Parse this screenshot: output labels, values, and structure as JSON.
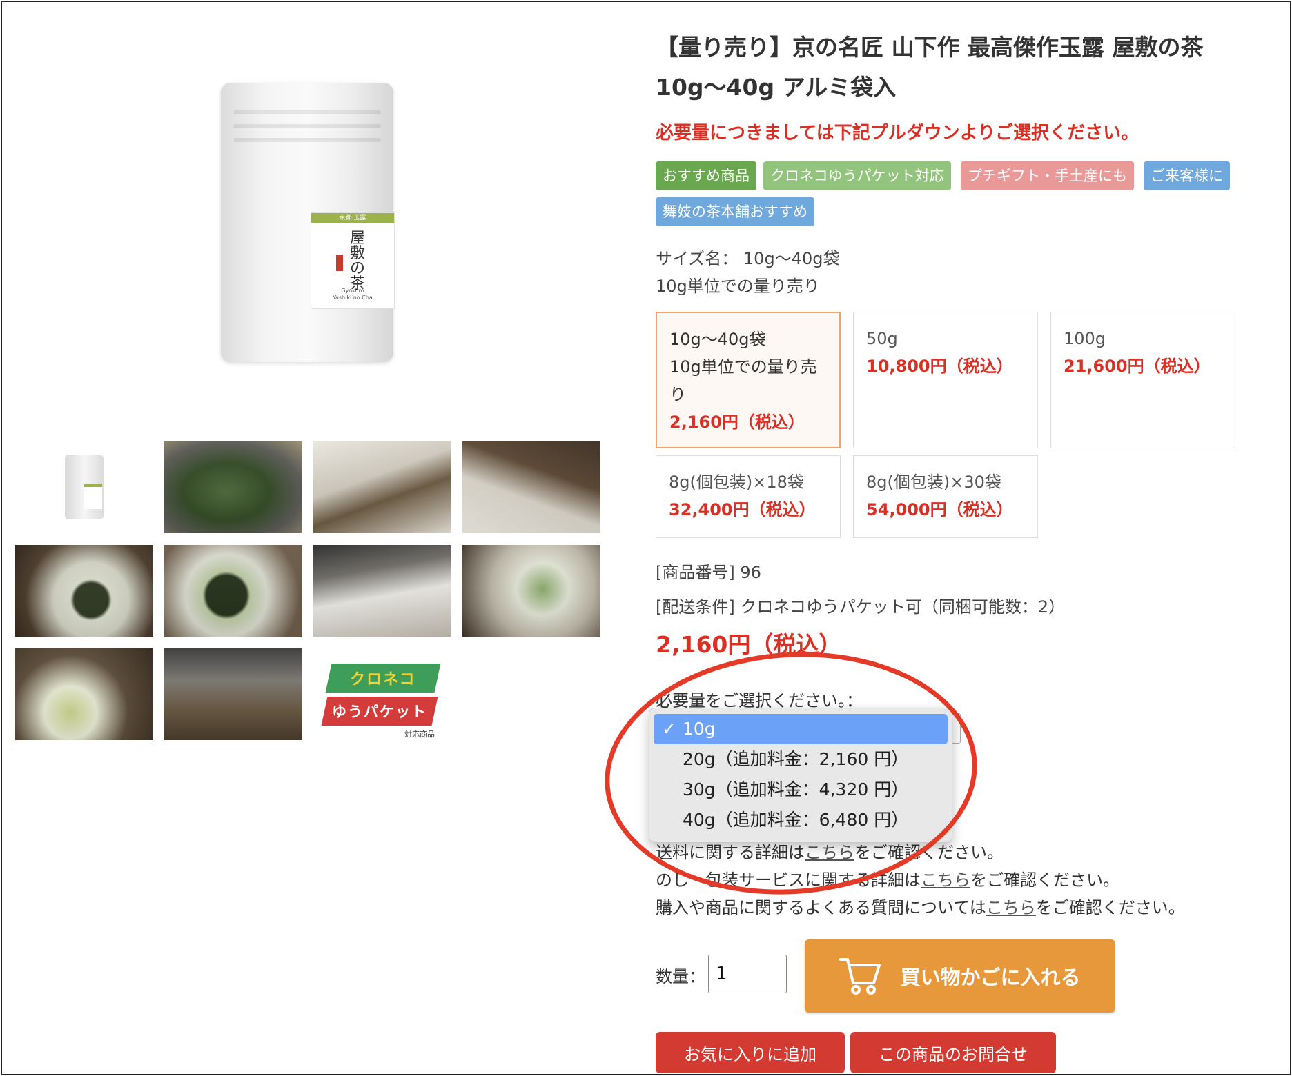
{
  "product": {
    "title_line1": "【量り売り】京の名匠 山下作 最高傑作玉露 屋敷の茶",
    "title_line2": "10g〜40g アルミ袋入",
    "notice": "必要量につきましては下記プルダウンよりご選択ください。",
    "tags": [
      {
        "label": "おすすめ商品",
        "color": "#6aa84f"
      },
      {
        "label": "クロネコゆうパケット対応",
        "color": "#93c47d"
      },
      {
        "label": "プチギフト・手土産にも",
        "color": "#ea9999"
      },
      {
        "label": "ご来客様に",
        "color": "#6fa8dc"
      },
      {
        "label": "舞妓の茶本舗おすすめ",
        "color": "#6fa8dc"
      }
    ],
    "size_name": "サイズ名： 10g〜40g袋",
    "size_note": "10g単位での量り売り",
    "options": [
      {
        "line1": "10g〜40g袋",
        "line2": "10g単位での量り売",
        "line3": "り",
        "price": "2,160円（税込）",
        "selected": true
      },
      {
        "line1": "50g",
        "price": "10,800円（税込）",
        "selected": false
      },
      {
        "line1": "100g",
        "price": "21,600円（税込）",
        "selected": false
      },
      {
        "line1": "8g(個包装)×18袋",
        "price": "32,400円（税込）",
        "selected": false
      },
      {
        "line1": "8g(個包装)×30袋",
        "price": "54,000円（税込）",
        "selected": false
      }
    ],
    "item_number": "[商品番号] 96",
    "shipping": "[配送条件] クロネコゆうパケット可（同梱可能数：2）",
    "price": "2,160円（税込）"
  },
  "pouch_label": {
    "band": "京都 玉露",
    "name": "屋敷の茶",
    "sub1": "Gyokuro",
    "sub2": "Yashiki no Cha"
  },
  "select": {
    "label": "必要量をご選択ください。：",
    "options": [
      {
        "check": "✓",
        "label": "10g"
      },
      {
        "label": "20g（追加料金：2,160 円）"
      },
      {
        "label": "30g（追加料金：4,320 円）"
      },
      {
        "label": "40g（追加料金：6,480 円）"
      }
    ]
  },
  "info": {
    "shipping_pre": "送料に関する詳細は",
    "shipping_link": "こちら",
    "shipping_post": "をご確認ください。",
    "wrap_pre": "のし・包装サービスに関する詳細は",
    "wrap_link": "こちら",
    "wrap_post": "をご確認ください。",
    "faq_pre": "購入や商品に関するよくある質問については",
    "faq_link": "こちら",
    "faq_post": "をご確認ください。"
  },
  "purchase": {
    "qty_label": "数量：",
    "qty_value": "1",
    "cart_label": "買い物かごに入れる",
    "favorite_label": "お気に入りに追加",
    "inquiry_label": "この商品のお問合せ"
  },
  "kuroneko_badge": {
    "top": "クロネコ",
    "bottom": "ゆうパケット",
    "note": "対応商品"
  },
  "colors": {
    "price_red": "#d93025",
    "cart_orange": "#e6983b",
    "button_red": "#d23a32",
    "annotation_red": "#e43b28",
    "dropdown_highlight": "#6ba1f7"
  }
}
